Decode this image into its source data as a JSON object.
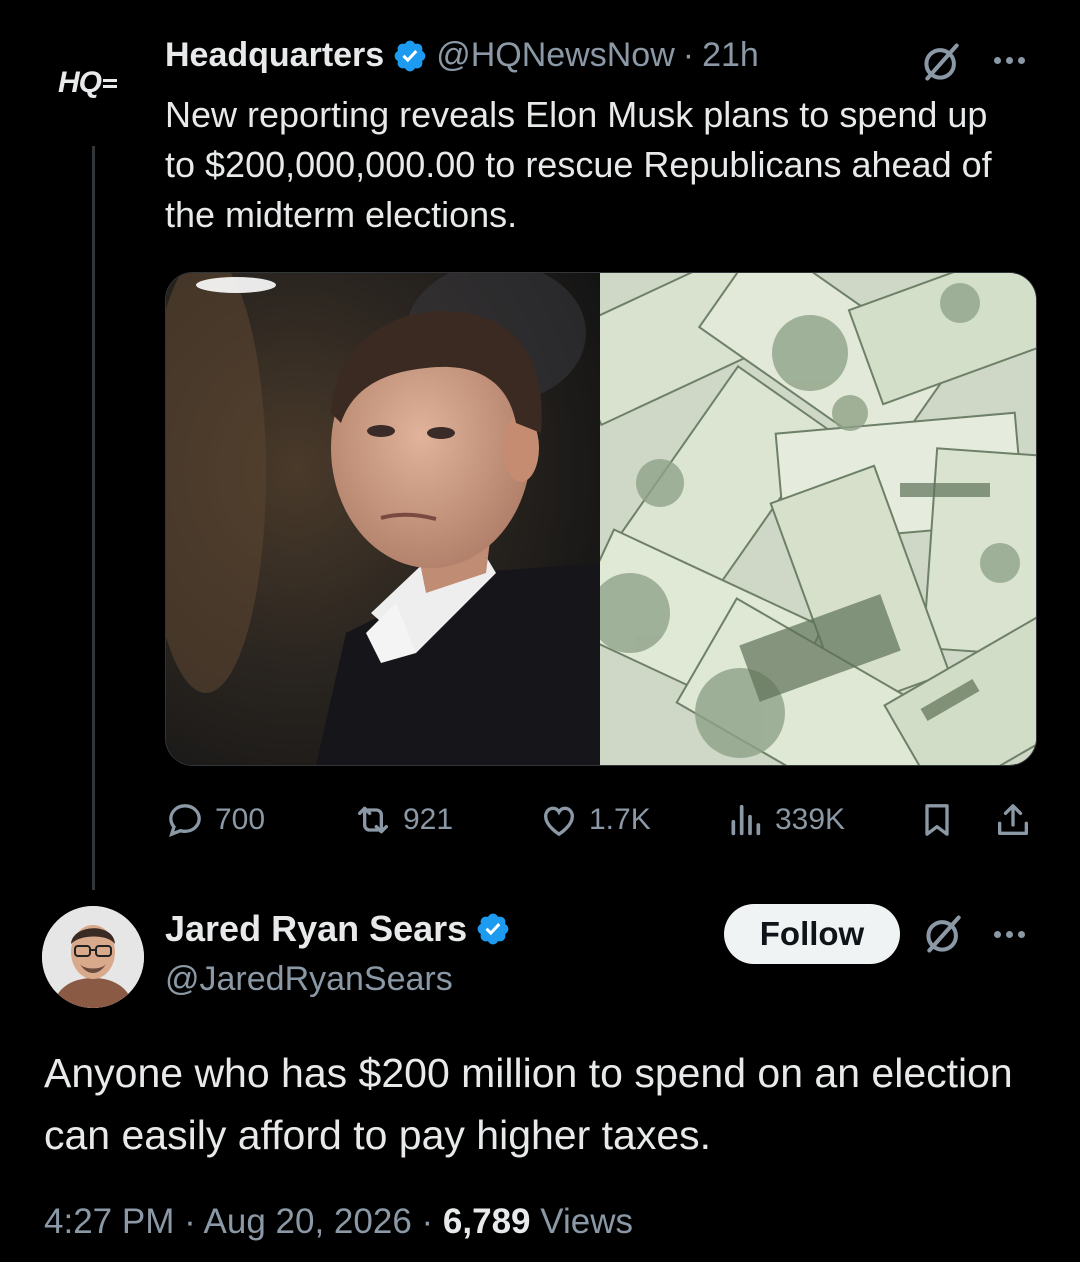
{
  "quoted_tweet": {
    "author_name": "Headquarters",
    "logo_text": "HQ",
    "handle": "@HQNewsNow",
    "separator": "·",
    "time": "21h",
    "text": "New reporting reveals Elon Musk plans to spend up to $200,000,000.00 to rescue Republicans ahead of the midterm elections.",
    "media": {
      "left_image": "portrait-photo",
      "right_image": "money-pile-photo"
    },
    "stats": {
      "replies": "700",
      "reposts": "921",
      "likes": "1.7K",
      "views": "339K"
    }
  },
  "reply_tweet": {
    "author_name": "Jared Ryan Sears",
    "handle": "@JaredRyanSears",
    "follow_label": "Follow",
    "text": "Anyone who has $200 million to spend on an election can easily afford to pay higher taxes.",
    "time": "4:27 PM",
    "date": "Aug 20, 2026",
    "separator": "·",
    "views_count": "6,789",
    "views_label": "Views"
  },
  "icons": {
    "verified": "verified-badge-icon",
    "grok": "grok-icon",
    "more": "more-icon",
    "reply": "reply-icon",
    "repost": "repost-icon",
    "like": "heart-icon",
    "views": "views-icon",
    "bookmark": "bookmark-icon",
    "share": "share-icon"
  },
  "colors": {
    "background": "#000000",
    "text": "#e7e9ea",
    "secondary": "#8b98a5",
    "verified": "#1d9bf0",
    "follow_bg": "#eff3f4"
  }
}
